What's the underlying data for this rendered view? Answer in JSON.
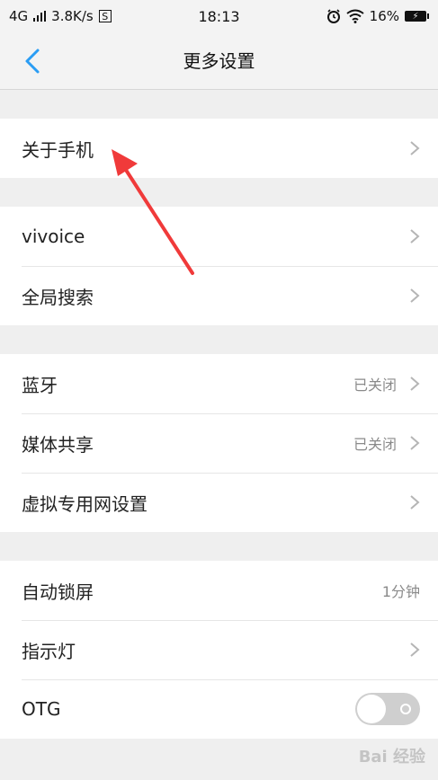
{
  "status_bar": {
    "network": "4G",
    "speed": "3.8K/s",
    "sim_label": "S",
    "time": "18:13",
    "battery": "16%"
  },
  "nav": {
    "title": "更多设置"
  },
  "groups": [
    {
      "rows": [
        {
          "label": "关于手机"
        }
      ]
    },
    {
      "rows": [
        {
          "label": "vivoice"
        },
        {
          "label": "全局搜索"
        }
      ]
    },
    {
      "rows": [
        {
          "label": "蓝牙",
          "value": "已关闭"
        },
        {
          "label": "媒体共享",
          "value": "已关闭"
        },
        {
          "label": "虚拟专用网设置"
        }
      ]
    },
    {
      "rows": [
        {
          "label": "自动锁屏",
          "value": "1分钟"
        },
        {
          "label": "指示灯"
        },
        {
          "label": "OTG",
          "toggle": "off"
        }
      ]
    }
  ],
  "colors": {
    "accent": "#2a9df4",
    "annotation_arrow": "#f03a3a"
  },
  "watermark": "Bai 经验"
}
